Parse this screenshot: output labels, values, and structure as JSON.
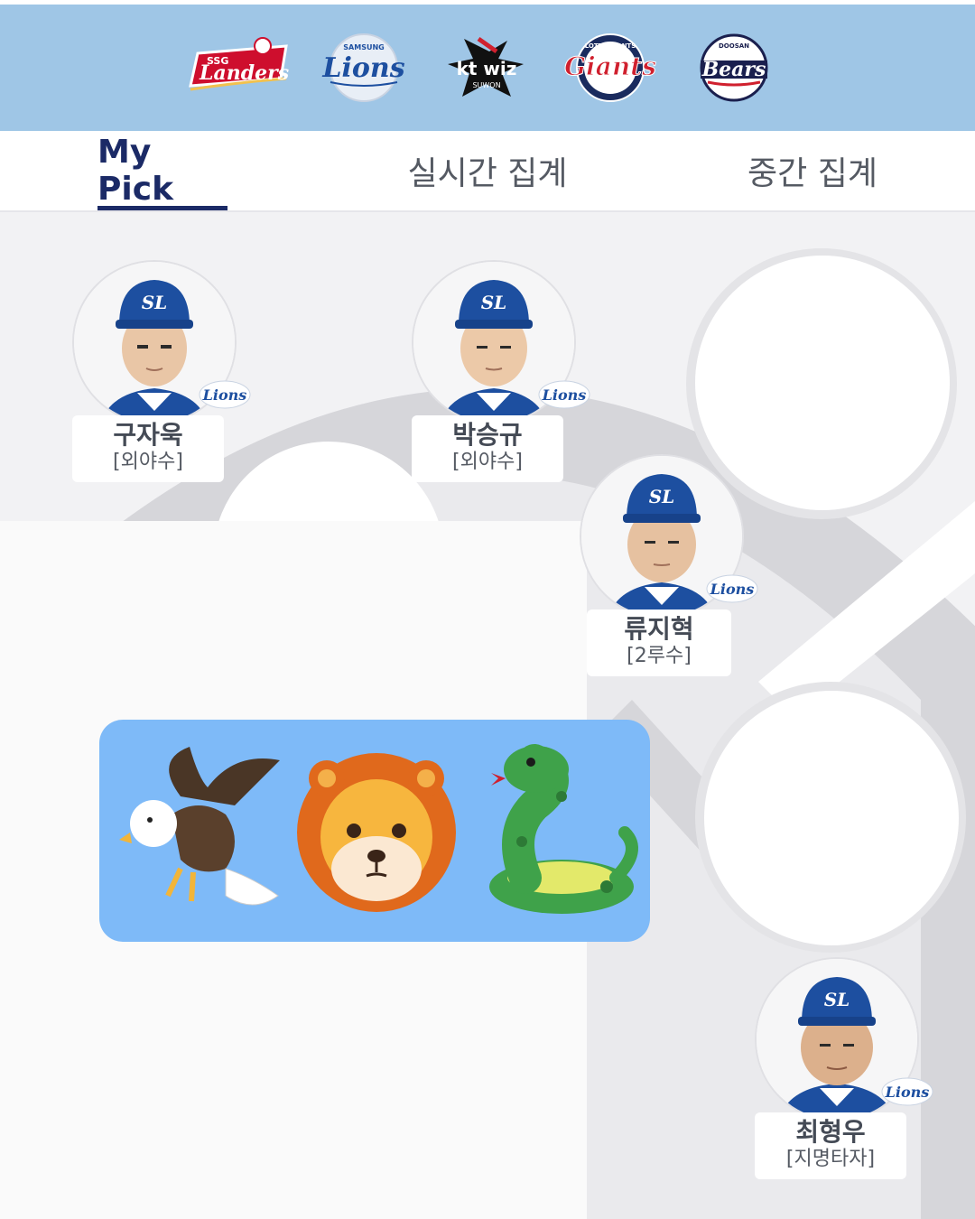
{
  "teams": [
    {
      "name": "SSG Landers",
      "logo_text": "Landers",
      "sub": "SSG",
      "color": "#ce0e2d"
    },
    {
      "name": "Samsung Lions",
      "logo_text": "Lions",
      "sub": "SAMSUNG",
      "color": "#1d4fa0"
    },
    {
      "name": "kt wiz",
      "logo_text": "kt wiz",
      "sub": "SUWON",
      "color": "#111111"
    },
    {
      "name": "Lotte Giants",
      "logo_text": "Giants",
      "sub": "LOTTE GIANTS",
      "color": "#d0202e"
    },
    {
      "name": "Doosan Bears",
      "logo_text": "Bears",
      "sub": "DOOSAN",
      "color": "#1a1f4e"
    }
  ],
  "tabs": [
    {
      "label": "My Pick",
      "active": true
    },
    {
      "label": "실시간 집계",
      "active": false
    },
    {
      "label": "중간 집계",
      "active": false
    }
  ],
  "players": [
    {
      "name": "구자욱",
      "position": "[외야수]",
      "team_badge": "Lions"
    },
    {
      "name": "박승규",
      "position": "[외야수]",
      "team_badge": "Lions"
    },
    {
      "name": "류지혁",
      "position": "[2루수]",
      "team_badge": "Lions"
    },
    {
      "name": "최형우",
      "position": "[지명타자]",
      "team_badge": "Lions"
    }
  ],
  "cap_logo": "SL",
  "emojis": [
    "eagle-icon",
    "lion-icon",
    "snake-icon"
  ],
  "colors": {
    "header_bg": "#9fc6e6",
    "tab_active": "#1b2a66",
    "bubble": "#7ebaf8",
    "cap_blue": "#1d4fa0"
  }
}
